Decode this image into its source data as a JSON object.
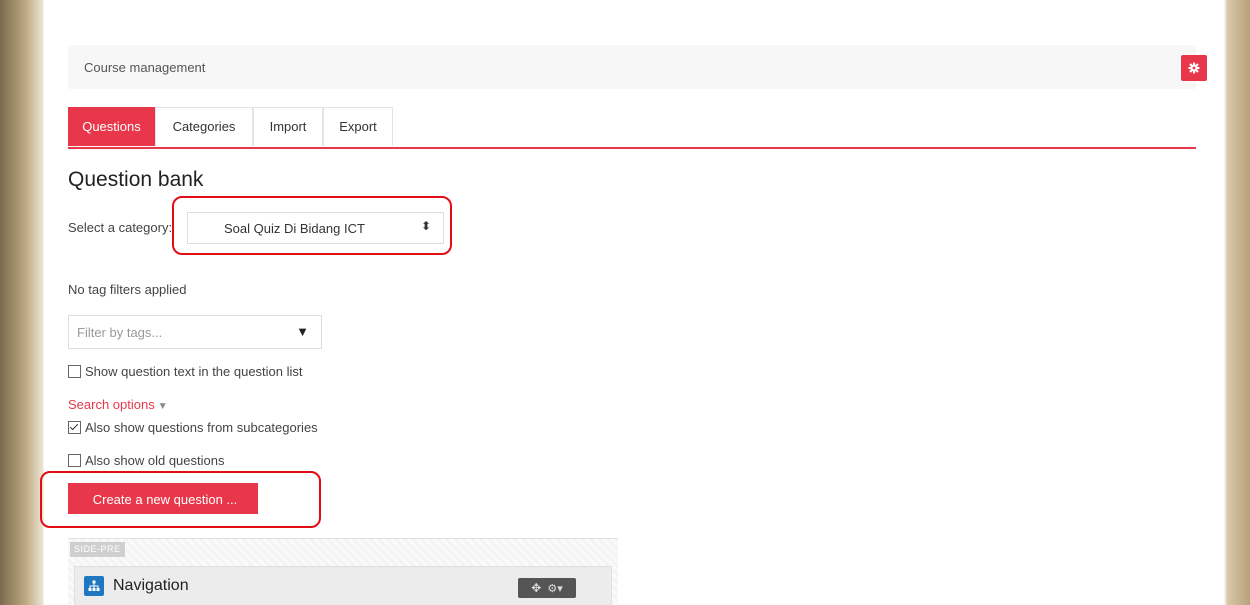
{
  "breadcrumb": {
    "text": "Course management"
  },
  "tabs": [
    {
      "label": "Questions",
      "active": true
    },
    {
      "label": "Categories",
      "active": false
    },
    {
      "label": "Import",
      "active": false
    },
    {
      "label": "Export",
      "active": false
    }
  ],
  "page_title": "Question bank",
  "category": {
    "label": "Select a category:",
    "selected": "Soal Quiz Di Bidang ICT"
  },
  "tags": {
    "status": "No tag filters applied",
    "placeholder": "Filter by tags..."
  },
  "options": {
    "show_question_text": {
      "label": "Show question text in the question list",
      "checked": false
    },
    "search_options": "Search options",
    "subcategories": {
      "label": "Also show questions from subcategories",
      "checked": true
    },
    "old_questions": {
      "label": "Also show old questions",
      "checked": false
    }
  },
  "create_button": "Create a new question ...",
  "block_region": {
    "tag": "SIDE-PRE",
    "navigation_title": "Navigation"
  },
  "colors": {
    "accent": "#e8374a",
    "highlight": "#e10f14",
    "nav_icon": "#1f77c2"
  },
  "icons": [
    "gear-icon",
    "navigation-icon",
    "move-icon",
    "block-settings-icon"
  ]
}
